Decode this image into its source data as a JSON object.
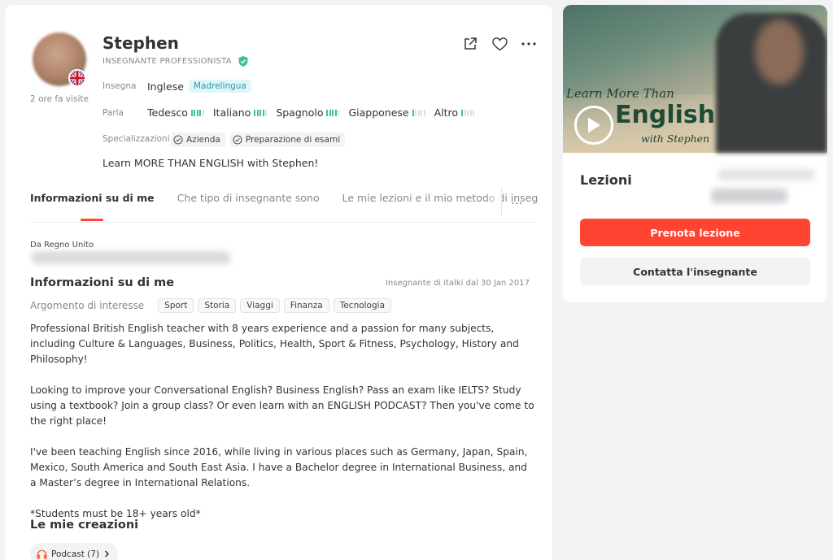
{
  "profile": {
    "name": "Stephen",
    "role": "INSEGNANTE PROFESSIONISTA",
    "last_visit": "2 ore fa visite",
    "tagline": "Learn MORE THAN ENGLISH with Stephen!"
  },
  "teaches": {
    "label": "Insegna",
    "language": "Inglese",
    "level_badge": "Madrelingua"
  },
  "speaks": {
    "label": "Parla",
    "languages": [
      {
        "name": "Tedesco",
        "level": 4
      },
      {
        "name": "Italiano",
        "level": 4
      },
      {
        "name": "Spagnolo",
        "level": 4
      },
      {
        "name": "Giapponese",
        "level": 1
      },
      {
        "name": "Altro",
        "level": 1
      }
    ]
  },
  "specializations": {
    "label": "Specializzazioni",
    "items": [
      "Azienda",
      "Preparazione di esami"
    ]
  },
  "tabs": [
    {
      "label": "Informazioni su di me",
      "active": true
    },
    {
      "label": "Che tipo di insegnante sono",
      "active": false
    },
    {
      "label": "Le mie lezioni e il mio metodo di inseg",
      "active": false
    }
  ],
  "tabs_more": "...",
  "about": {
    "from": "Da Regno Unito",
    "title": "Informazioni su di me",
    "since": "Insegnante di italki dal 30 Jan 2017",
    "interests_label": "Argomento di interesse",
    "interests": [
      "Sport",
      "Storia",
      "Viaggi",
      "Finanza",
      "Tecnologia"
    ],
    "paragraphs": [
      "Professional British English teacher with 8 years experience and a passion for many subjects, including Culture & Languages, Business, Politics, Health, Sport & Fitness, Psychology, History and Philosophy!",
      "Looking to improve your Conversational English? Business English? Pass an exam like IELTS? Study using a textbook? Join a group class? Or even learn with an ENGLISH PODCAST? Then you've come to the right place!",
      "I've been teaching English since 2016, while living in various places such as Germany, Japan, Spain, Mexico, South America and South East Asia. I have a Bachelor degree in International Business, and a Master’s degree in International Relations.",
      "*Students must be 18+ years old*"
    ]
  },
  "creations": {
    "title": "Le mie creazioni",
    "podcast_label": "Podcast (7)"
  },
  "sidebar": {
    "video": {
      "line1": "Learn More Than",
      "line2": "English",
      "line3": "with Stephen"
    },
    "lessons_title": "Lezioni",
    "book_button": "Prenota lezione",
    "contact_button": "Contatta l'insegnante"
  },
  "colors": {
    "accent": "#ff4432",
    "native_badge_bg": "#e0f5f7",
    "native_badge_text": "#2b9aa8",
    "level_bar_on": "#3ec48a",
    "verified": "#3ec48a"
  }
}
